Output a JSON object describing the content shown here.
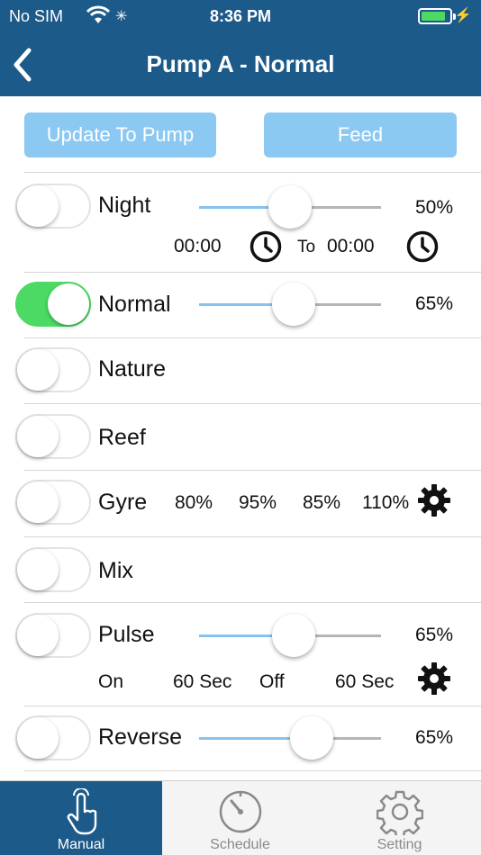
{
  "status": {
    "carrier": "No SIM",
    "time": "8:36 PM",
    "battery_level": 0.85
  },
  "header": {
    "title": "Pump A - Normal"
  },
  "buttons": {
    "update": "Update To Pump",
    "feed": "Feed"
  },
  "modes": {
    "night": {
      "label": "Night",
      "on": false,
      "percent": "50%",
      "level": 0.5,
      "from": "00:00",
      "to_label": "To",
      "to": "00:00"
    },
    "normal": {
      "label": "Normal",
      "on": true,
      "percent": "65%",
      "level": 0.52
    },
    "nature": {
      "label": "Nature",
      "on": false
    },
    "reef": {
      "label": "Reef",
      "on": false
    },
    "gyre": {
      "label": "Gyre",
      "on": false,
      "values": [
        "80%",
        "95%",
        "85%",
        "110%"
      ]
    },
    "mix": {
      "label": "Mix",
      "on": false
    },
    "pulse": {
      "label": "Pulse",
      "on": false,
      "percent": "65%",
      "level": 0.52,
      "on_label": "On",
      "on_time": "60 Sec",
      "off_label": "Off",
      "off_time": "60 Sec"
    },
    "reverse": {
      "label": "Reverse",
      "on": false,
      "percent": "65%",
      "level": 0.62
    }
  },
  "tabs": [
    {
      "label": "Manual",
      "icon": "hand-tap-icon",
      "active": true
    },
    {
      "label": "Schedule",
      "icon": "dial-icon",
      "active": false
    },
    {
      "label": "Setting",
      "icon": "gear-icon",
      "active": false
    }
  ],
  "colors": {
    "header": "#1c5a8a",
    "button": "#8bc8f2",
    "toggle_on": "#4cd964",
    "slider_fill": "#86c3ee"
  }
}
